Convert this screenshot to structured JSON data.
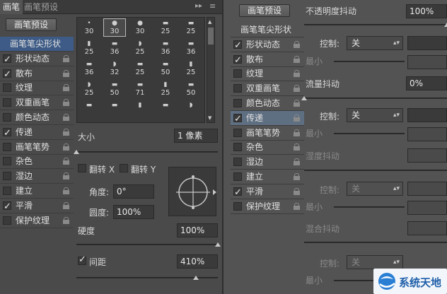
{
  "left_panel": {
    "tabs": [
      {
        "label": "画笔"
      },
      {
        "label": "画笔预设"
      }
    ],
    "preset_button": "画笔预设",
    "list": [
      {
        "label": "画笔笔尖形状",
        "checked": false,
        "highlight": true
      },
      {
        "label": "形状动态",
        "checked": true
      },
      {
        "label": "散布",
        "checked": true
      },
      {
        "label": "纹理",
        "checked": false
      },
      {
        "label": "双重画笔",
        "checked": false
      },
      {
        "label": "颜色动态",
        "checked": false
      },
      {
        "label": "传递",
        "checked": true
      },
      {
        "label": "画笔笔势",
        "checked": false
      },
      {
        "label": "杂色",
        "checked": false
      },
      {
        "label": "湿边",
        "checked": false
      },
      {
        "label": "建立",
        "checked": false
      },
      {
        "label": "平滑",
        "checked": true
      },
      {
        "label": "保护纹理",
        "checked": false
      }
    ],
    "brush_sizes": [
      [
        "30",
        "30",
        "30",
        "25",
        "25"
      ],
      [
        "25",
        "36",
        "25",
        "36",
        "36"
      ],
      [
        "36",
        "32",
        "25",
        "50",
        "25"
      ],
      [
        "25",
        "50",
        "71",
        "25",
        "50"
      ],
      [
        "",
        "",
        "",
        "",
        ""
      ]
    ],
    "size": {
      "label": "大小",
      "value": "1 像素"
    },
    "flip_x": "翻转 X",
    "flip_y": "翻转 Y",
    "angle": {
      "label": "角度:",
      "value": "0°"
    },
    "roundness": {
      "label": "圆度:",
      "value": "100%"
    },
    "hardness": {
      "label": "硬度",
      "value": "100%"
    },
    "spacing": {
      "label": "间距",
      "value": "410%",
      "checked": true
    }
  },
  "right_panel": {
    "preset_button": "画笔预设",
    "list": [
      {
        "label": "画笔笔尖形状",
        "checked": false,
        "highlight": false
      },
      {
        "label": "形状动态",
        "checked": true
      },
      {
        "label": "散布",
        "checked": true
      },
      {
        "label": "纹理",
        "checked": false
      },
      {
        "label": "双重画笔",
        "checked": false
      },
      {
        "label": "颜色动态",
        "checked": false
      },
      {
        "label": "传递",
        "checked": true,
        "highlight": true
      },
      {
        "label": "画笔笔势",
        "checked": false
      },
      {
        "label": "杂色",
        "checked": false
      },
      {
        "label": "湿边",
        "checked": false
      },
      {
        "label": "建立",
        "checked": false
      },
      {
        "label": "平滑",
        "checked": true
      },
      {
        "label": "保护纹理",
        "checked": false
      }
    ],
    "opacity_jitter": {
      "label": "不透明度抖动",
      "value": "100%"
    },
    "control1": {
      "label": "控制:",
      "value": "关"
    },
    "min1": "最小",
    "flow_jitter": {
      "label": "流量抖动",
      "value": "0%"
    },
    "control2": {
      "label": "控制:",
      "value": "关"
    },
    "min2": "最小",
    "wet_jitter": "湿度抖动",
    "control3": {
      "label": "控制:",
      "value": "关"
    },
    "min3": "最小",
    "mix_jitter": "混合抖动",
    "control4": {
      "label": "控制:",
      "value": "关"
    },
    "min4": "最小",
    "watermark": "系统天地"
  }
}
